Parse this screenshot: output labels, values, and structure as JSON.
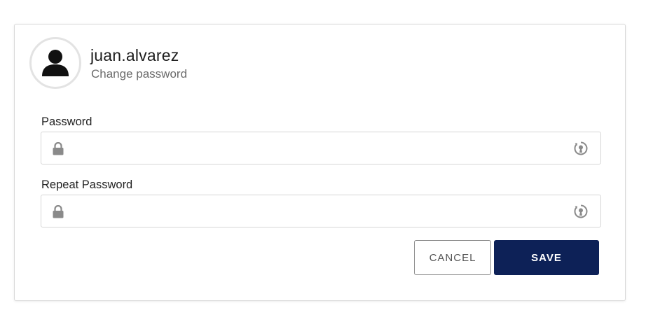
{
  "user": {
    "username": "juan.alvarez",
    "subtitle": "Change password",
    "avatar_icon": "user-silhouette-icon"
  },
  "form": {
    "password": {
      "label": "Password",
      "value": "",
      "leading_icon": "lock-icon",
      "trailing_icon": "toggle-visibility-icon"
    },
    "repeat_password": {
      "label": "Repeat Password",
      "value": "",
      "leading_icon": "lock-icon",
      "trailing_icon": "toggle-visibility-icon"
    }
  },
  "actions": {
    "cancel_label": "CANCEL",
    "save_label": "SAVE"
  },
  "colors": {
    "primary": "#0d2157",
    "border": "#d6d6d6",
    "icon": "#8a8a8a",
    "avatar_icon": "#111111"
  }
}
